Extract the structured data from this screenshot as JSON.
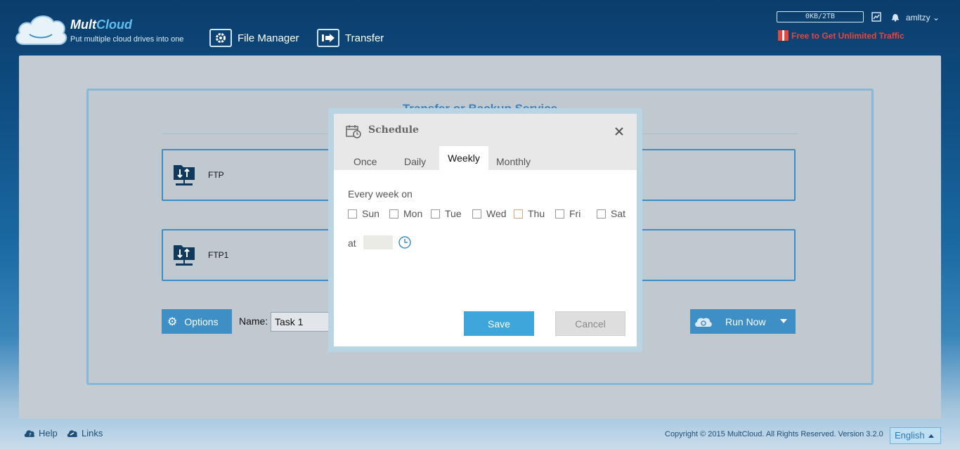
{
  "header": {
    "app_name_a": "Mult",
    "app_name_b": "Cloud",
    "tagline": "Put multiple cloud drives into one",
    "nav": [
      {
        "label": "File Manager",
        "icon": "gear-icon"
      },
      {
        "label": "Transfer",
        "icon": "transfer-icon"
      }
    ],
    "traffic": "0KB/2TB",
    "username": "amltzy",
    "promo": "Free to Get Unlimited Traffic"
  },
  "main": {
    "service_title": "Transfer or Backup Service",
    "source_drive": "FTP",
    "target_drive": "FTP1",
    "options_label": "Options",
    "name_label": "Name:",
    "name_value": "Task 1",
    "run_label": "Run Now"
  },
  "modal": {
    "title": "Schedule",
    "tabs": [
      "Once",
      "Daily",
      "Weekly",
      "Monthly"
    ],
    "active_tab": "Weekly",
    "every_label": "Every week on",
    "days": [
      "Sun",
      "Mon",
      "Tue",
      "Wed",
      "Thu",
      "Fri",
      "Sat"
    ],
    "at_label": "at",
    "time_value": "",
    "save_label": "Save",
    "cancel_label": "Cancel"
  },
  "footer": {
    "help": "Help",
    "links": "Links",
    "copyright": "Copyright © 2015 MultCloud. All Rights Reserved. Version 3.2.0",
    "language": "English"
  },
  "colors": {
    "accent": "#3f8fc7",
    "save": "#3fa6dc",
    "promo": "#e8463c"
  }
}
